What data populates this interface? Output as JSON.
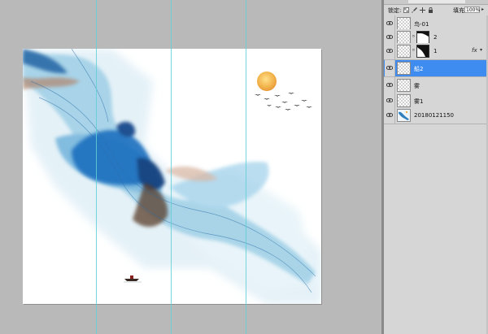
{
  "layers_panel": {
    "lock_label": "锁定:",
    "lock_icons": [
      "transparency-lock-icon",
      "brush-lock-icon",
      "move-lock-icon",
      "padlock-icon"
    ],
    "fill_label": "填充:",
    "fill_value": "100%",
    "layers": [
      {
        "name": "鸟-01",
        "selected": false,
        "has_mask": false,
        "has_fx": false
      },
      {
        "name": "2",
        "selected": false,
        "has_mask": true,
        "has_fx": false
      },
      {
        "name": "1",
        "selected": false,
        "has_mask": true,
        "has_fx": true,
        "fx_label": "fx"
      },
      {
        "name": "船2",
        "selected": true,
        "has_mask": false,
        "has_fx": false
      },
      {
        "name": "雾",
        "selected": false,
        "has_mask": false,
        "has_fx": false
      },
      {
        "name": "雾1",
        "selected": false,
        "has_mask": false,
        "has_fx": false
      },
      {
        "name": "20180121150",
        "selected": false,
        "has_mask": false,
        "has_fx": false
      }
    ]
  },
  "colors": {
    "workspace": "#b9b9b9",
    "panel": "#d6d6d6",
    "selection": "#3e8cf0",
    "guide": "#5fd0d6",
    "ink_blue": "#1e6fb8",
    "sun": "#f0b24a"
  }
}
